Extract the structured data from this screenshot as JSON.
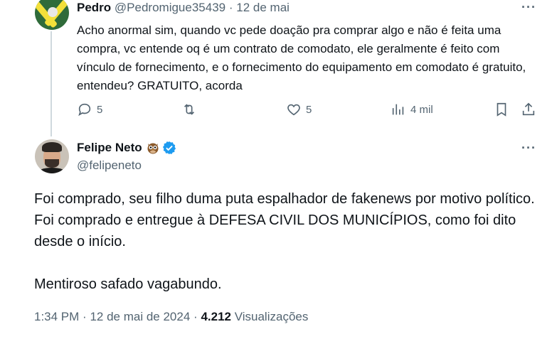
{
  "reply": {
    "name": "Pedro",
    "handle": "@Pedromigue35439",
    "separator": "·",
    "date": "12 de mai",
    "more": "···",
    "text": "Acho anormal sim, quando vc pede doação pra comprar algo e não é feita uma compra, vc entende oq é um contrato de comodato, ele geralmente é feito com vínculo de fornecimento, e o fornecimento do equipamento em comodato é gratuito, entendeu? GRATUITO, acorda",
    "actions": {
      "replies": "5",
      "likes": "5",
      "views": "4 mil"
    },
    "icons": [
      "reply-icon",
      "retweet-icon",
      "heart-icon",
      "analytics-icon",
      "bookmark-icon",
      "share-icon"
    ]
  },
  "main": {
    "name": "Felipe Neto",
    "emoji": "owl",
    "handle": "@felipeneto",
    "more": "···",
    "paragraphs": [
      "Foi comprado, seu filho duma puta espalhador de fakenews por motivo político. Foi comprado e entregue à DEFESA CIVIL DOS MUNICÍPIOS, como foi dito desde o início.",
      "Mentiroso safado vagabundo."
    ],
    "footer": {
      "time": "1:34 PM",
      "sep1": "·",
      "date": "12 de mai de 2024",
      "sep2": "·",
      "views_count": "4.212",
      "views_label": "Visualizações"
    }
  },
  "colors": {
    "text": "#0f1419",
    "secondary": "#536471",
    "verified": "#1d9bf0",
    "thread_line": "#cfd9de"
  }
}
